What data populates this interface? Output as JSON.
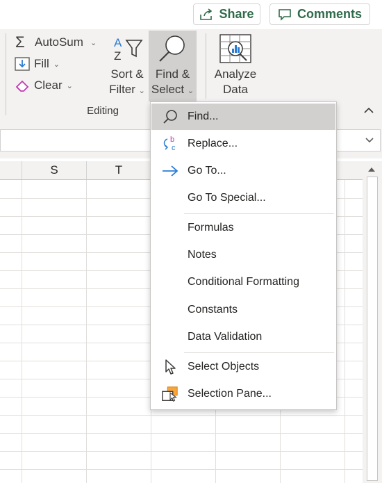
{
  "top": {
    "share_label": "Share",
    "comments_label": "Comments"
  },
  "ribbon": {
    "autosum_label": "AutoSum",
    "fill_label": "Fill",
    "clear_label": "Clear",
    "sort_label_1": "Sort &",
    "sort_label_2": "Filter",
    "find_label_1": "Find &",
    "find_label_2": "Select",
    "analyze_label_1": "Analyze",
    "analyze_label_2": "Data",
    "group_label": "Editing"
  },
  "grid": {
    "columns": [
      "S",
      "T"
    ]
  },
  "menu": {
    "items": [
      {
        "label": "Find...",
        "icon": "search-icon"
      },
      {
        "label": "Replace...",
        "icon": "replace-icon"
      },
      {
        "label": "Go To...",
        "icon": "arrow-right-icon"
      },
      {
        "label": "Go To Special...",
        "icon": ""
      },
      {
        "label": "Formulas",
        "icon": ""
      },
      {
        "label": "Notes",
        "icon": ""
      },
      {
        "label": "Conditional Formatting",
        "icon": ""
      },
      {
        "label": "Constants",
        "icon": ""
      },
      {
        "label": "Data Validation",
        "icon": ""
      },
      {
        "label": "Select Objects",
        "icon": "pointer-icon"
      },
      {
        "label": "Selection Pane...",
        "icon": "selection-pane-icon"
      }
    ]
  },
  "colors": {
    "accent_green": "#2f6b49",
    "hover_gray": "#d2d0ce",
    "icon_blue": "#2b7cd3"
  }
}
